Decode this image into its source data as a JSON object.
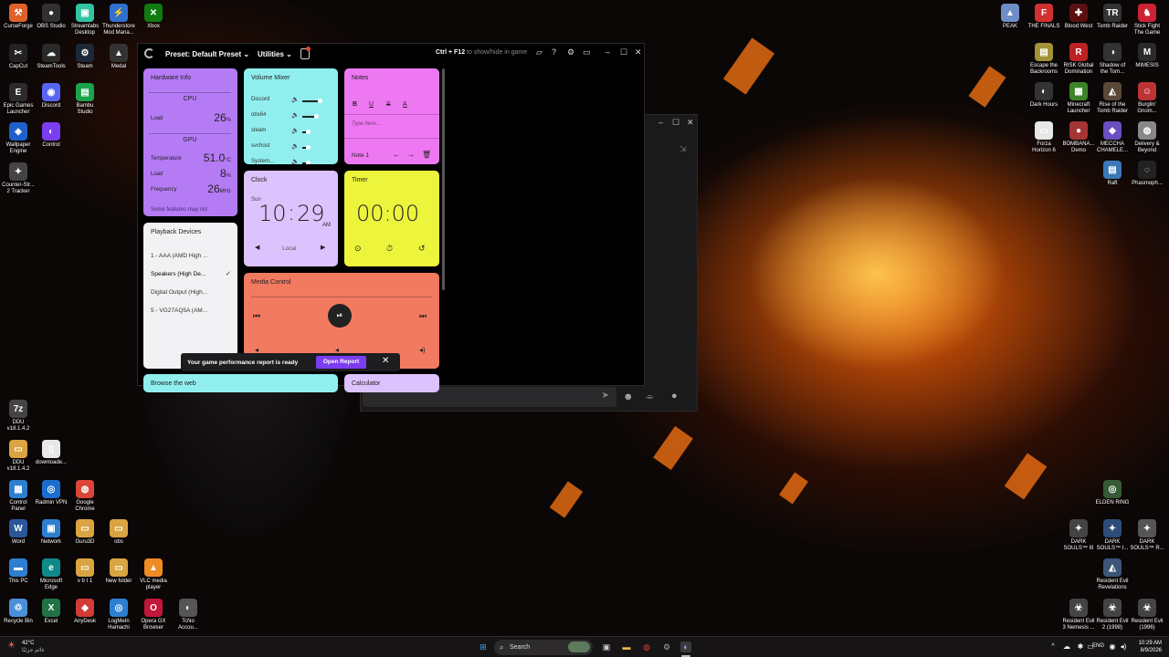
{
  "desktop": {
    "left_icons": [
      {
        "label": "CurseForge",
        "color": "#e0612a",
        "glyph": "⚒"
      },
      {
        "label": "OBS Studio",
        "color": "#303030",
        "glyph": "●"
      },
      {
        "label": "Streamlabs\nDesktop",
        "color": "#31c3a2",
        "glyph": "▣"
      },
      {
        "label": "Thunderstore\nMod Mana...",
        "color": "#2f6fd0",
        "glyph": "⚡"
      },
      {
        "label": "Xbox",
        "color": "#107c10",
        "glyph": "✕"
      },
      {
        "label": "CapCut",
        "color": "#222222",
        "glyph": "✂"
      },
      {
        "label": "SteamTools",
        "color": "#2a2a2a",
        "glyph": "☁"
      },
      {
        "label": "Steam",
        "color": "#1b2838",
        "glyph": "⚙"
      },
      {
        "label": "Medal",
        "color": "#333333",
        "glyph": "▲"
      },
      {
        "label": "Epic Games\nLauncher",
        "color": "#2b2b2b",
        "glyph": "E"
      },
      {
        "label": "Discord",
        "color": "#5865f2",
        "glyph": "◉"
      },
      {
        "label": "Bambu\nStudio",
        "color": "#1aa34a",
        "glyph": "▤"
      },
      {
        "label": "Wallpaper\nEngine",
        "color": "#1e5fc9",
        "glyph": "◈"
      },
      {
        "label": "Control",
        "color": "#7b3df0",
        "glyph": "◐"
      },
      {
        "label": "Counter-Str...\n2 Tracker",
        "color": "#444444",
        "glyph": "✦"
      },
      {
        "label": "DDU\nv18.1.4.2",
        "color": "#444444",
        "glyph": "7z"
      },
      {
        "label": "DDU\nv18.1.4.2",
        "color": "#d9a441",
        "glyph": "▭"
      },
      {
        "label": "downloade...",
        "color": "#e8e8e8",
        "glyph": "▯"
      },
      {
        "label": "Control\nPanel",
        "color": "#2d7fd0",
        "glyph": "▦"
      },
      {
        "label": "Radmin VPN",
        "color": "#1b6ed0",
        "glyph": "◎"
      },
      {
        "label": "Google\nChrome",
        "color": "#db4437",
        "glyph": "◍"
      },
      {
        "label": "Word",
        "color": "#2b579a",
        "glyph": "W"
      },
      {
        "label": "Network",
        "color": "#2d7fd0",
        "glyph": "▣"
      },
      {
        "label": "Guru3D",
        "color": "#d9a441",
        "glyph": "▭"
      },
      {
        "label": "obs",
        "color": "#d9a441",
        "glyph": "▭"
      },
      {
        "label": "This PC",
        "color": "#2d7fd0",
        "glyph": "▬"
      },
      {
        "label": "Microsoft\nEdge",
        "color": "#0f8a8a",
        "glyph": "e"
      },
      {
        "label": "v b t 1",
        "color": "#d9a441",
        "glyph": "▭"
      },
      {
        "label": "New folder",
        "color": "#d9a441",
        "glyph": "▭"
      },
      {
        "label": "VLC media\nplayer",
        "color": "#f08a24",
        "glyph": "▲"
      },
      {
        "label": "Recycle Bin",
        "color": "#4a90d9",
        "glyph": "♲"
      },
      {
        "label": "Excel",
        "color": "#217346",
        "glyph": "X"
      },
      {
        "label": "AnyDesk",
        "color": "#d33b35",
        "glyph": "◆"
      },
      {
        "label": "LogMeIn\nHamachi",
        "color": "#2d7fd0",
        "glyph": "◎"
      },
      {
        "label": "Opera GX\nBrowser",
        "color": "#c2163b",
        "glyph": "O"
      },
      {
        "label": "TcNo\nAccou...",
        "color": "#555555",
        "glyph": "◐"
      }
    ],
    "right_icons": [
      {
        "label": "PEAK",
        "color": "#6d8ec7",
        "glyph": "▲"
      },
      {
        "label": "THE FINALS",
        "color": "#d23030",
        "glyph": "F"
      },
      {
        "label": "Blood West",
        "color": "#5a1010",
        "glyph": "✚"
      },
      {
        "label": "Tomb Raider",
        "color": "#333333",
        "glyph": "TR"
      },
      {
        "label": "Stick Fight\nThe Game",
        "color": "#c23",
        "glyph": "♞"
      },
      {
        "label": "Escape the\nBackrooms",
        "color": "#a39238",
        "glyph": "▤"
      },
      {
        "label": "RISK Global\nDomination",
        "color": "#b22",
        "glyph": "R"
      },
      {
        "label": "Shadow of\nthe Tom...",
        "color": "#333333",
        "glyph": "◑"
      },
      {
        "label": "MIMESIS",
        "color": "#2a2a2a",
        "glyph": "M"
      },
      {
        "label": "Dark Hours",
        "color": "#333333",
        "glyph": "◐"
      },
      {
        "label": "Minecraft\nLauncher",
        "color": "#3c8527",
        "glyph": "▦"
      },
      {
        "label": "Rise of the\nTomb Raider",
        "color": "#5a4838",
        "glyph": "◭"
      },
      {
        "label": "Burglin'\nGnom...",
        "color": "#b33",
        "glyph": "☺"
      },
      {
        "label": "Forza\nHorizon 6",
        "color": "#e7e7e7",
        "glyph": "▭"
      },
      {
        "label": "BOMBANA...\nDemo",
        "color": "#a73434",
        "glyph": "●"
      },
      {
        "label": "MECCHA\nCHAMELE...",
        "color": "#6a4ec2",
        "glyph": "◆"
      },
      {
        "label": "Delivery &\nBeyond",
        "color": "#888888",
        "glyph": "◍"
      },
      {
        "label": "Raft",
        "color": "#3a78b8",
        "glyph": "▤"
      },
      {
        "label": "Phasmoph...",
        "color": "#222222",
        "glyph": "◌"
      },
      {
        "label": "ELDEN RING",
        "color": "#355a35",
        "glyph": "◎"
      },
      {
        "label": "DARK\nSOULS™ III",
        "color": "#444444",
        "glyph": "✦"
      },
      {
        "label": "DARK\nSOULS™ I...",
        "color": "#2e4c78",
        "glyph": "✦"
      },
      {
        "label": "DARK\nSOULS™ R...",
        "color": "#555555",
        "glyph": "✦"
      },
      {
        "label": "Resident Evil\nRevelations",
        "color": "#3c5578",
        "glyph": "◭"
      },
      {
        "label": "Resident Evil\n3 Nemesis ...",
        "color": "#444444",
        "glyph": "☣"
      },
      {
        "label": "Resident Evil\n2 (1998)",
        "color": "#444444",
        "glyph": "☣"
      },
      {
        "label": "Resident Evil\n(1996)",
        "color": "#444444",
        "glyph": "☣"
      }
    ]
  },
  "app": {
    "preset_label": "Preset: Default Preset",
    "utilities_label": "Utilities",
    "hint_key": "Ctrl + F12",
    "hint_text": " to show/hide in game",
    "hardware": {
      "title": "Hardware Info",
      "cpu_label": "CPU",
      "cpu_load_label": "Load",
      "cpu_load_value": "26",
      "cpu_load_unit": "%",
      "gpu_label": "GPU",
      "gpu_temp_label": "Temperature",
      "gpu_temp_value": "51.0",
      "gpu_temp_unit": "°C",
      "gpu_load_label": "Load",
      "gpu_load_value": "8",
      "gpu_load_unit": "%",
      "gpu_freq_label": "Frequency",
      "gpu_freq_value": "26",
      "gpu_freq_unit": "MHz",
      "footer": "Some features may not"
    },
    "volume": {
      "title": "Volume Mixer",
      "rows": [
        {
          "name": "Discord",
          "level": 0.45
        },
        {
          "name": "obs64",
          "level": 0.35
        },
        {
          "name": "steam",
          "level": 0.1
        },
        {
          "name": "svchost",
          "level": 0.1
        },
        {
          "name": "System...",
          "level": 0.1
        }
      ]
    },
    "notes": {
      "title": "Notes",
      "bold": "B",
      "underline": "U",
      "strike": "S",
      "color": "A",
      "placeholder": "Type here...",
      "page_label": "Note 1"
    },
    "clock": {
      "title": "Clock",
      "day": "Sun",
      "hours": "10",
      "sep": ":",
      "minutes": "29",
      "ampm": "AM",
      "zone": "Local"
    },
    "timer": {
      "title": "Timer",
      "value": "00:00"
    },
    "playback": {
      "title": "Playback Devices",
      "devices": [
        "1 - AAA (AMD High ...",
        "Speakers (High De...",
        "Digital Output (High...",
        "5 - VG27AQ5A (AM..."
      ],
      "selected_index": 1
    },
    "media": {
      "title": "Media Control"
    },
    "browse_title": "Browse the web",
    "calc_title": "Calculator",
    "toast": {
      "message": "Your game performance report is ready",
      "button": "Open Report"
    }
  },
  "taskbar": {
    "search_label": "Search",
    "weather_temp": "42°C",
    "weather_desc": "غائم جزئيًا",
    "lang": "ENG",
    "time": "10:29 AM",
    "date": "8/9/2026"
  }
}
